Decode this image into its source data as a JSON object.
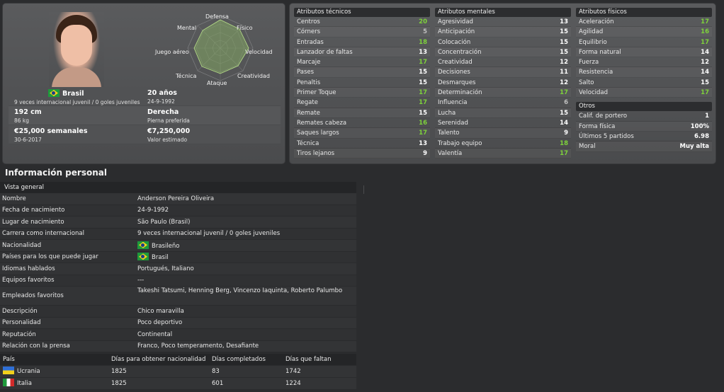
{
  "profile": {
    "nationality": "Brasil",
    "intl_caps": "9 veces internacional juvenil / 0 goles juveniles",
    "age": "20 años",
    "dob": "24-9-1992",
    "height": "192 cm",
    "weight": "86 kg",
    "foot": "Derecha",
    "foot_label": "Pierna preferida",
    "wage": "€25,000 semanales",
    "contract_end": "30-6-2017",
    "value": "€7,250,000",
    "value_label": "Valor estimado"
  },
  "radar": {
    "labels": {
      "top": "Defensa",
      "top_right": "Físico",
      "right": "Velocidad",
      "bottom_right": "Creatividad",
      "bottom": "Ataque",
      "bottom_left": "Técnica",
      "left": "Juego aéreo",
      "top_left": "Mental"
    }
  },
  "technical": {
    "header": "Atributos técnicos",
    "rows": [
      {
        "name": "Centros",
        "value": "20",
        "color": "green"
      },
      {
        "name": "Córners",
        "value": "5",
        "color": "grey"
      },
      {
        "name": "Entradas",
        "value": "18",
        "color": "green"
      },
      {
        "name": "Lanzador de faltas",
        "value": "13",
        "color": "white"
      },
      {
        "name": "Marcaje",
        "value": "17",
        "color": "green"
      },
      {
        "name": "Pases",
        "value": "15",
        "color": "white"
      },
      {
        "name": "Penaltis",
        "value": "15",
        "color": "white"
      },
      {
        "name": "Primer Toque",
        "value": "17",
        "color": "green"
      },
      {
        "name": "Regate",
        "value": "17",
        "color": "green"
      },
      {
        "name": "Remate",
        "value": "15",
        "color": "white"
      },
      {
        "name": "Remates cabeza",
        "value": "16",
        "color": "green"
      },
      {
        "name": "Saques largos",
        "value": "17",
        "color": "green"
      },
      {
        "name": "Técnica",
        "value": "13",
        "color": "white"
      },
      {
        "name": "Tiros lejanos",
        "value": "9",
        "color": "white"
      }
    ]
  },
  "mental": {
    "header": "Atributos mentales",
    "rows": [
      {
        "name": "Agresividad",
        "value": "13",
        "color": "white"
      },
      {
        "name": "Anticipación",
        "value": "15",
        "color": "white"
      },
      {
        "name": "Colocación",
        "value": "15",
        "color": "white"
      },
      {
        "name": "Concentración",
        "value": "15",
        "color": "white"
      },
      {
        "name": "Creatividad",
        "value": "12",
        "color": "white"
      },
      {
        "name": "Decisiones",
        "value": "11",
        "color": "white"
      },
      {
        "name": "Desmarques",
        "value": "12",
        "color": "white"
      },
      {
        "name": "Determinación",
        "value": "17",
        "color": "green"
      },
      {
        "name": "Influencia",
        "value": "6",
        "color": "grey"
      },
      {
        "name": "Lucha",
        "value": "15",
        "color": "white"
      },
      {
        "name": "Serenidad",
        "value": "14",
        "color": "white"
      },
      {
        "name": "Talento",
        "value": "9",
        "color": "white"
      },
      {
        "name": "Trabajo equipo",
        "value": "18",
        "color": "green"
      },
      {
        "name": "Valentía",
        "value": "17",
        "color": "green"
      }
    ]
  },
  "physical": {
    "header": "Atributos físicos",
    "rows": [
      {
        "name": "Aceleración",
        "value": "17",
        "color": "green"
      },
      {
        "name": "Agilidad",
        "value": "16",
        "color": "green"
      },
      {
        "name": "Equilibrio",
        "value": "17",
        "color": "green"
      },
      {
        "name": "Forma natural",
        "value": "14",
        "color": "white"
      },
      {
        "name": "Fuerza",
        "value": "12",
        "color": "white"
      },
      {
        "name": "Resistencia",
        "value": "14",
        "color": "white"
      },
      {
        "name": "Salto",
        "value": "15",
        "color": "white"
      },
      {
        "name": "Velocidad",
        "value": "17",
        "color": "green"
      }
    ]
  },
  "others": {
    "header": "Otros",
    "rows": [
      {
        "name": "Calif. de portero",
        "value": "1"
      },
      {
        "name": "Forma física",
        "value": "100%"
      },
      {
        "name": "Últimos 5 partidos",
        "value": "6.98"
      },
      {
        "name": "Moral",
        "value": "Muy alta"
      }
    ]
  },
  "personal": {
    "title": "Información personal",
    "overview_header": "Vista general",
    "rows": [
      {
        "key": "Nombre",
        "value": "Anderson Pereira Oliveira"
      },
      {
        "key": "Fecha de nacimiento",
        "value": "24-9-1992"
      },
      {
        "key": "Lugar de nacimiento",
        "value": "São Paulo (Brasil)"
      },
      {
        "key": "Carrera como internacional",
        "value": "9 veces internacional juvenil / 0 goles juveniles"
      },
      {
        "key": "Nacionalidad",
        "value": "Brasileño"
      },
      {
        "key": "Países para los que puede jugar",
        "value": "Brasil"
      },
      {
        "key": "Idiomas hablados",
        "value": "Portugués, Italiano"
      },
      {
        "key": "Equipos favoritos",
        "value": "---"
      },
      {
        "key": "Empleados favoritos",
        "value": "Takeshi Tatsumi, Henning Berg, Vincenzo Iaquinta, Roberto Palumbo"
      },
      {
        "key": "Descripción",
        "value": "Chico maravilla"
      },
      {
        "key": "Personalidad",
        "value": "Poco deportivo"
      },
      {
        "key": "Reputación",
        "value": "Continental"
      },
      {
        "key": "Relación con la prensa",
        "value": "Franco, Poco temperamento, Desafiante"
      }
    ]
  },
  "nationality_table": {
    "headers": [
      "País",
      "Días para obtener nacionalidad",
      "Días completados",
      "Días que faltan"
    ],
    "rows": [
      {
        "country": "Ucrania",
        "flag": "ukraine-flag-icon",
        "days_needed": "1825",
        "days_done": "83",
        "days_left": "1742"
      },
      {
        "country": "Italia",
        "flag": "italy-flag-icon",
        "days_needed": "1825",
        "days_done": "601",
        "days_left": "1224"
      }
    ]
  }
}
